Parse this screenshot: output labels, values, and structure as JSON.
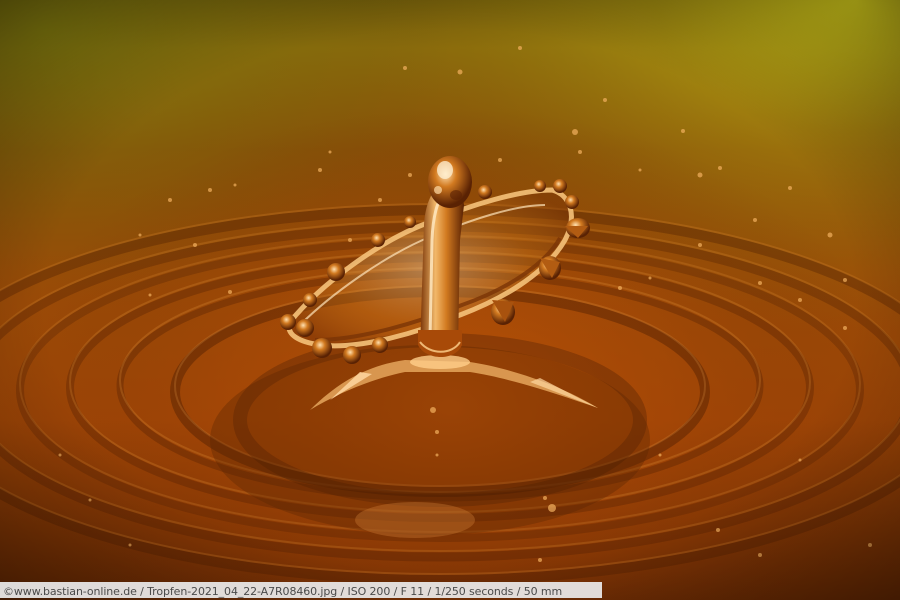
{
  "photo": {
    "subject": "water droplet splash crown in amber liquid with concentric ripples"
  },
  "caption": {
    "text": "©www.bastian-online.de / Tropfen-2021_04_22-A7R08460.jpg / ISO 200 / F 11 / 1/250 seconds  / 50 mm"
  },
  "colors": {
    "top_glow": "#d8d21a",
    "mid_amber": "#a5560a",
    "deep_orange": "#b44a06",
    "dark_shadow": "#3a1a03",
    "highlight": "#f5c27a"
  }
}
